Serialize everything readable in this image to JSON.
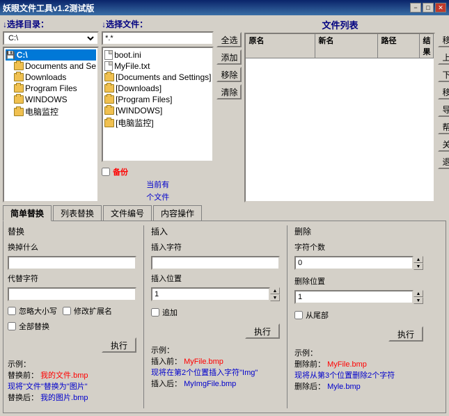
{
  "window": {
    "title": "妖眼文件工具v1.2测试版",
    "min_btn": "−",
    "max_btn": "□",
    "close_btn": "✕"
  },
  "dir_panel": {
    "header": "↓选择目录：",
    "drive": "C:\\",
    "items": [
      {
        "name": "C:\\",
        "indent": 0,
        "type": "drive"
      },
      {
        "name": "Documents and Se",
        "indent": 1,
        "type": "folder"
      },
      {
        "name": "Downloads",
        "indent": 1,
        "type": "folder"
      },
      {
        "name": "Program Files",
        "indent": 1,
        "type": "folder"
      },
      {
        "name": "WINDOWS",
        "indent": 1,
        "type": "folder"
      },
      {
        "name": "电脑监控",
        "indent": 1,
        "type": "folder"
      }
    ]
  },
  "file_panel": {
    "header": "↓选择文件：",
    "filter": "*.*",
    "items": [
      {
        "name": "boot.ini",
        "type": "file"
      },
      {
        "name": "MyFile.txt",
        "type": "file"
      },
      {
        "name": "[Documents and Settings]",
        "type": "folder"
      },
      {
        "name": "[Downloads]",
        "type": "folder"
      },
      {
        "name": "[Program Files]",
        "type": "folder"
      },
      {
        "name": "[WINDOWS]",
        "type": "folder"
      },
      {
        "name": "[电脑监控]",
        "type": "folder"
      }
    ],
    "backup_label": "备份",
    "current_label": "当前有",
    "count_label": "个文件"
  },
  "action_buttons": {
    "select_all": "全选",
    "add": "添加",
    "remove": "移除",
    "clear": "清除"
  },
  "file_table": {
    "header": "文件列表",
    "cols": [
      "原名",
      "新名",
      "路径",
      "结果"
    ]
  },
  "right_buttons": {
    "top": "移顶",
    "up": "上移",
    "down": "下移",
    "bottom": "移底",
    "export": "导出",
    "help": "帮助",
    "about": "关于",
    "exit": "退出"
  },
  "tabs": {
    "items": [
      "简单替换",
      "列表替换",
      "文件编号",
      "内容操作"
    ],
    "active": 0
  },
  "tab_replace": {
    "section_replace": {
      "title": "替换",
      "what_label": "换掉什么",
      "what_value": "",
      "with_label": "代替字符",
      "with_value": "",
      "ignore_case_label": "忽略大小写",
      "modify_ext_label": "修改扩展名",
      "all_replace_label": "全部替换",
      "exec_btn": "执行",
      "example_title": "示例：",
      "example_before_label": "替换前：",
      "example_before_val": "我的文件.bmp",
      "example_action": "现将\"文件\"替换为\"图片\"",
      "example_after_label": "替换后：",
      "example_after_val": "我的图片.bmp"
    },
    "section_insert": {
      "title": "插入",
      "char_label": "插入字符",
      "char_value": "",
      "pos_label": "插入位置",
      "pos_value": "1",
      "append_label": "追加",
      "exec_btn": "执行",
      "example_title": "示例：",
      "example_before_label": "插入前：",
      "example_before_val": "MyFile.bmp",
      "example_action": "现将在第2个位置插入字符\"Img\"",
      "example_after_label": "插入后：",
      "example_after_val": "MyImgFile.bmp"
    },
    "section_delete": {
      "title": "删除",
      "count_label": "字符个数",
      "count_value": "0",
      "pos_label": "删除位置",
      "pos_value": "1",
      "from_end_label": "从尾部",
      "exec_btn": "执行",
      "example_title": "示例：",
      "example_before_label": "删除前：",
      "example_before_val": "MyFile.bmp",
      "example_action": "现将从第3个位置删除2个字符",
      "example_after_label": "删除后：",
      "example_after_val": "Myle.bmp"
    }
  }
}
